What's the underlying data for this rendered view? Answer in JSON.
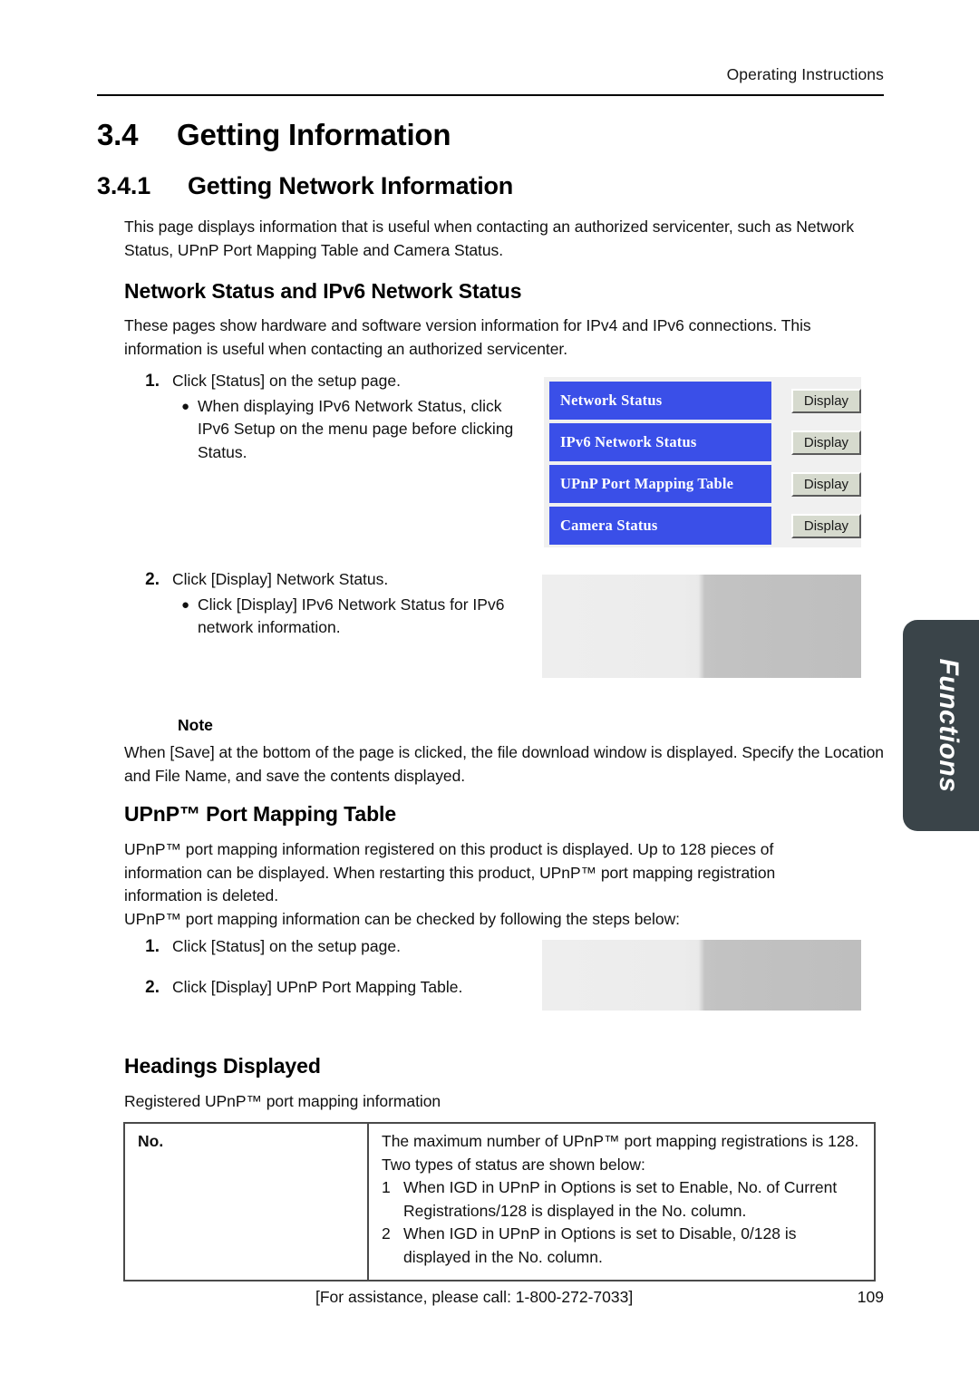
{
  "header": {
    "running_title": "Operating Instructions"
  },
  "sections": {
    "s34": {
      "number": "3.4",
      "title": "Getting Information"
    },
    "s341": {
      "number": "3.4.1",
      "title": "Getting Network Information"
    },
    "intro_paragraph": "This page displays information that is useful when contacting an authorized servicenter, such as Network Status, UPnP Port Mapping Table and Camera Status."
  },
  "network_status": {
    "heading": "Network Status and IPv6 Network Status",
    "paragraph": "These pages show hardware and software version information for IPv4 and IPv6 connections. This information is useful when contacting an authorized servicenter.",
    "steps": [
      {
        "number": "1.",
        "text": "Click [Status] on the setup page.",
        "bullet": "When displaying IPv6 Network Status, click IPv6 Setup on the menu page before clicking Status."
      },
      {
        "number": "2.",
        "text": "Click [Display] Network Status.",
        "bullet": "Click [Display] IPv6 Network Status for IPv6 network information."
      }
    ]
  },
  "status_panel": {
    "rows": [
      {
        "label": "Network Status",
        "button": "Display"
      },
      {
        "label": "IPv6 Network Status",
        "button": "Display"
      },
      {
        "label": "UPnP Port Mapping Table",
        "button": "Display"
      },
      {
        "label": "Camera Status",
        "button": "Display"
      }
    ],
    "colors": {
      "row_blue": "#3A4FE8",
      "panel_bg": "#f0f0f0",
      "button_face": "#D6DACE"
    }
  },
  "note": {
    "label": "Note",
    "text": "When [Save] at the bottom of the page is clicked, the file download window is displayed. Specify the Location and File Name, and save the contents displayed."
  },
  "upnp": {
    "heading": "UPnP™ Port Mapping Table",
    "paragraph": "UPnP™ port mapping information registered on this product is displayed. Up to 128 pieces of information can be displayed. When restarting this product, UPnP™ port mapping registration information is deleted.",
    "paragraph2": "UPnP™ port mapping information can be checked by following the steps below:",
    "steps": [
      {
        "number": "1.",
        "text": "Click [Status] on the setup page."
      },
      {
        "number": "2.",
        "text": "Click [Display] UPnP Port Mapping Table."
      }
    ]
  },
  "headings_displayed": {
    "heading": "Headings Displayed",
    "caption": "Registered UPnP™ port mapping information",
    "table": {
      "rows": [
        {
          "name": "No.",
          "description_line1": "The maximum number of UPnP™ port mapping registrations is 128.",
          "description_line2": "Two types of status are shown below:",
          "items": [
            {
              "num": "1",
              "text": "When IGD in UPnP in Options is set to Enable, No. of Current Registrations/128 is displayed in the No. column."
            },
            {
              "num": "2",
              "text": "When IGD in UPnP in Options is set to Disable, 0/128 is displayed in the No. column."
            }
          ]
        }
      ]
    }
  },
  "side_tab": {
    "label": "Functions",
    "color": "#3A4449"
  },
  "footer": {
    "assistance": "[For assistance, please call: 1-800-272-7033]",
    "page_number": "109"
  }
}
